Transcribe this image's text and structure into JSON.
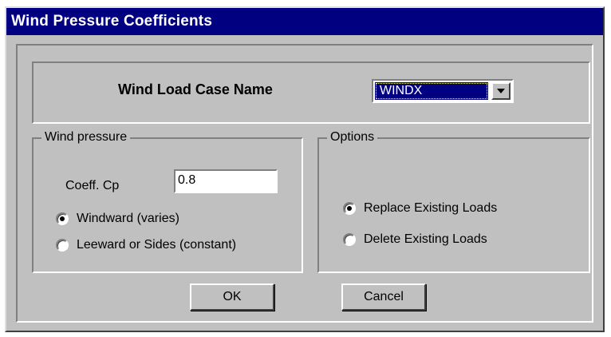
{
  "window": {
    "title": "Wind Pressure Coefficients"
  },
  "load_case": {
    "label": "Wind Load Case Name",
    "selected": "WINDX"
  },
  "wind_pressure": {
    "group_label": "Wind pressure",
    "coeff_label": "Coeff. Cp",
    "coeff_value": "0.8",
    "radio_windward": "Windward (varies)",
    "radio_leeward": "Leeward or Sides (constant)",
    "selected": "windward"
  },
  "options": {
    "group_label": "Options",
    "radio_replace": "Replace Existing Loads",
    "radio_delete": "Delete Existing Loads",
    "selected": "replace"
  },
  "buttons": {
    "ok": "OK",
    "cancel": "Cancel"
  },
  "colors": {
    "titlebar": "#000080",
    "face": "#c0c0c0",
    "selection": "#000080"
  }
}
